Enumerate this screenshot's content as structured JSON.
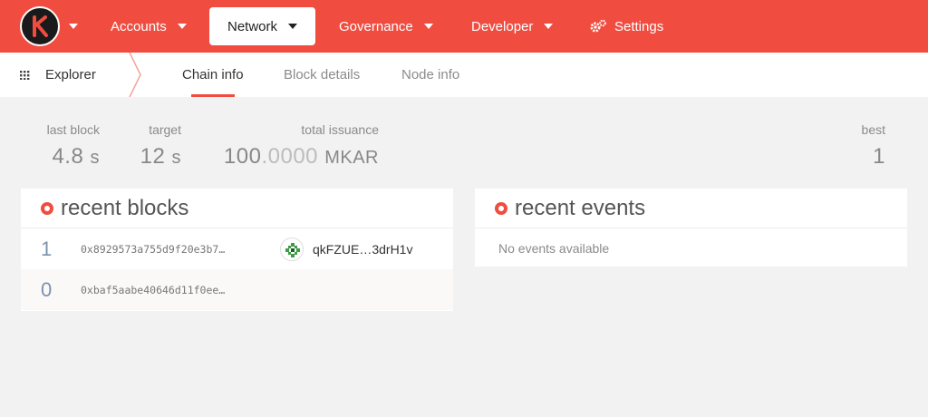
{
  "nav": {
    "menu": [
      {
        "label": "Accounts"
      },
      {
        "label": "Network"
      },
      {
        "label": "Governance"
      },
      {
        "label": "Developer"
      },
      {
        "label": "Settings"
      }
    ],
    "logo_letter": "K",
    "accent": "#f04d40"
  },
  "subnav": {
    "section": "Explorer",
    "tabs": [
      {
        "label": "Chain info"
      },
      {
        "label": "Block details"
      },
      {
        "label": "Node info"
      }
    ]
  },
  "stats": {
    "last_block": {
      "label": "last block",
      "value": "4.8",
      "unit": "s"
    },
    "target": {
      "label": "target",
      "value": "12",
      "unit": "s"
    },
    "total_issuance": {
      "label": "total issuance",
      "int": "100",
      "frac": ".0000",
      "unit": "MKAR"
    },
    "best": {
      "label": "best",
      "value": "1"
    }
  },
  "recent_blocks": {
    "title": "recent blocks",
    "rows": [
      {
        "number": "1",
        "hash": "0x8929573a755d9f20e3b7…",
        "author": "qkFZUE…3drH1v"
      },
      {
        "number": "0",
        "hash": "0xbaf5aabe40646d11f0ee…",
        "author": ""
      }
    ]
  },
  "recent_events": {
    "title": "recent events",
    "empty": "No events available"
  }
}
